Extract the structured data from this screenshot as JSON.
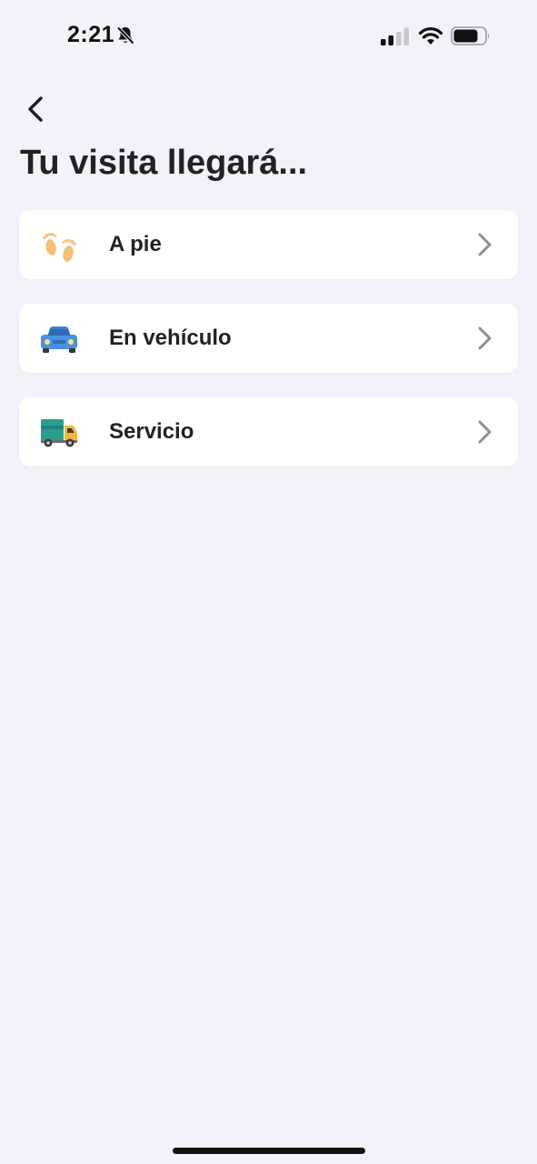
{
  "status_bar": {
    "time": "2:21"
  },
  "header": {
    "title": "Tu visita llegará..."
  },
  "options": [
    {
      "label": "A pie",
      "icon": "footprints-icon"
    },
    {
      "label": "En vehículo",
      "icon": "car-icon"
    },
    {
      "label": "Servicio",
      "icon": "truck-icon"
    }
  ],
  "colors": {
    "background": "#f2f2fb",
    "card": "#ffffff",
    "text": "#222226",
    "chevron": "#8e8e93"
  }
}
